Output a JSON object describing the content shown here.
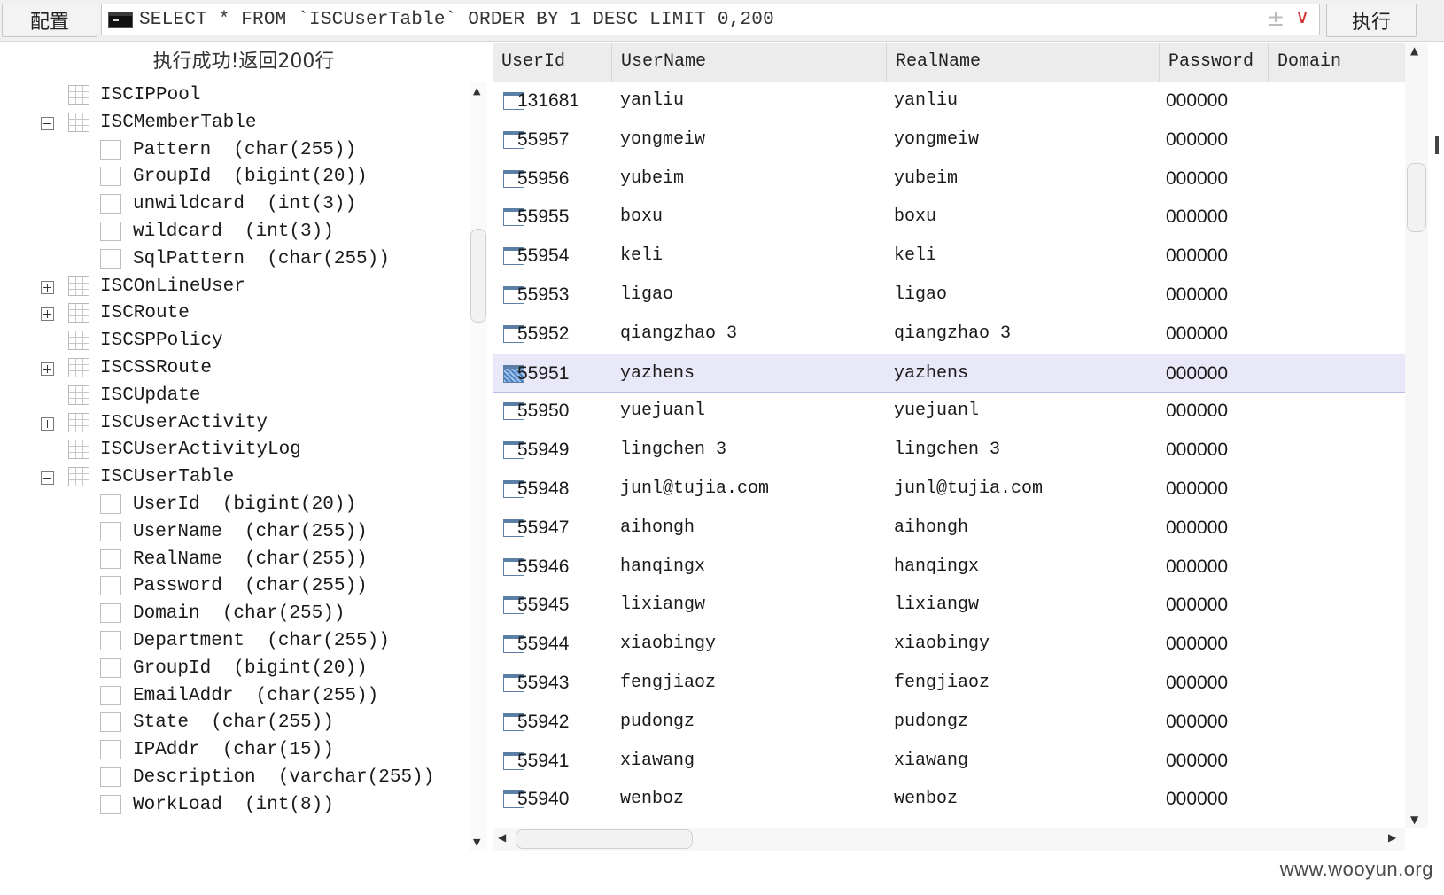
{
  "toolbar": {
    "config_label": "配置",
    "sql_query": "SELECT * FROM `ISCUserTable` ORDER BY 1 DESC LIMIT 0,200",
    "pin_glyph": "±",
    "dropdown_glyph": "∨",
    "execute_label": "执行"
  },
  "status": {
    "message": "执行成功!返回200行"
  },
  "tree": {
    "nodes": [
      {
        "type": "table",
        "toggle": "none",
        "label": "ISCIPPool"
      },
      {
        "type": "table",
        "toggle": "minus",
        "label": "ISCMemberTable"
      },
      {
        "type": "column",
        "label": "Pattern  (char(255))"
      },
      {
        "type": "column",
        "label": "GroupId  (bigint(20))"
      },
      {
        "type": "column",
        "label": "unwildcard  (int(3))"
      },
      {
        "type": "column",
        "label": "wildcard  (int(3))"
      },
      {
        "type": "column",
        "label": "SqlPattern  (char(255))"
      },
      {
        "type": "table",
        "toggle": "plus",
        "label": "ISCOnLineUser"
      },
      {
        "type": "table",
        "toggle": "plus",
        "label": "ISCRoute"
      },
      {
        "type": "table",
        "toggle": "none",
        "label": "ISCSPPolicy"
      },
      {
        "type": "table",
        "toggle": "plus",
        "label": "ISCSSRoute"
      },
      {
        "type": "table",
        "toggle": "none",
        "label": "ISCUpdate"
      },
      {
        "type": "table",
        "toggle": "plus",
        "label": "ISCUserActivity"
      },
      {
        "type": "table",
        "toggle": "none",
        "label": "ISCUserActivityLog"
      },
      {
        "type": "table",
        "toggle": "minus",
        "label": "ISCUserTable"
      },
      {
        "type": "column",
        "label": "UserId  (bigint(20))"
      },
      {
        "type": "column",
        "label": "UserName  (char(255))"
      },
      {
        "type": "column",
        "label": "RealName  (char(255))"
      },
      {
        "type": "column",
        "label": "Password  (char(255))"
      },
      {
        "type": "column",
        "label": "Domain  (char(255))"
      },
      {
        "type": "column",
        "label": "Department  (char(255))"
      },
      {
        "type": "column",
        "label": "GroupId  (bigint(20))"
      },
      {
        "type": "column",
        "label": "EmailAddr  (char(255))"
      },
      {
        "type": "column",
        "label": "State  (char(255))"
      },
      {
        "type": "column",
        "label": "IPAddr  (char(15))"
      },
      {
        "type": "column",
        "label": "Description  (varchar(255))"
      },
      {
        "type": "column",
        "label": "WorkLoad  (int(8))"
      }
    ]
  },
  "grid": {
    "columns": [
      "UserId",
      "UserName",
      "RealName",
      "Password",
      "Domain"
    ],
    "selected_row": 7,
    "rows": [
      [
        "131681",
        "yanliu",
        "yanliu",
        "000000"
      ],
      [
        "55957",
        "yongmeiw",
        "yongmeiw",
        "000000"
      ],
      [
        "55956",
        "yubeim",
        "yubeim",
        "000000"
      ],
      [
        "55955",
        "boxu",
        "boxu",
        "000000"
      ],
      [
        "55954",
        "keli",
        "keli",
        "000000"
      ],
      [
        "55953",
        "ligao",
        "ligao",
        "000000"
      ],
      [
        "55952",
        "qiangzhao_3",
        "qiangzhao_3",
        "000000"
      ],
      [
        "55951",
        "yazhens",
        "yazhens",
        "000000"
      ],
      [
        "55950",
        "yuejuanl",
        "yuejuanl",
        "000000"
      ],
      [
        "55949",
        "lingchen_3",
        "lingchen_3",
        "000000"
      ],
      [
        "55948",
        "junl@tujia.com",
        "junl@tujia.com",
        "000000"
      ],
      [
        "55947",
        "aihongh",
        "aihongh",
        "000000"
      ],
      [
        "55946",
        "hanqingx",
        "hanqingx",
        "000000"
      ],
      [
        "55945",
        "lixiangw",
        "lixiangw",
        "000000"
      ],
      [
        "55944",
        "xiaobingy",
        "xiaobingy",
        "000000"
      ],
      [
        "55943",
        "fengjiaoz",
        "fengjiaoz",
        "000000"
      ],
      [
        "55942",
        "pudongz",
        "pudongz",
        "000000"
      ],
      [
        "55941",
        "xiawang",
        "xiawang",
        "000000"
      ],
      [
        "55940",
        "wenboz",
        "wenboz",
        "000000"
      ]
    ]
  },
  "watermark": "www.wooyun.org",
  "colors": {
    "selected_row_bg": "#e8e8f8",
    "dropdown_accent": "#d63333",
    "row_icon": "#5b7fa6"
  }
}
